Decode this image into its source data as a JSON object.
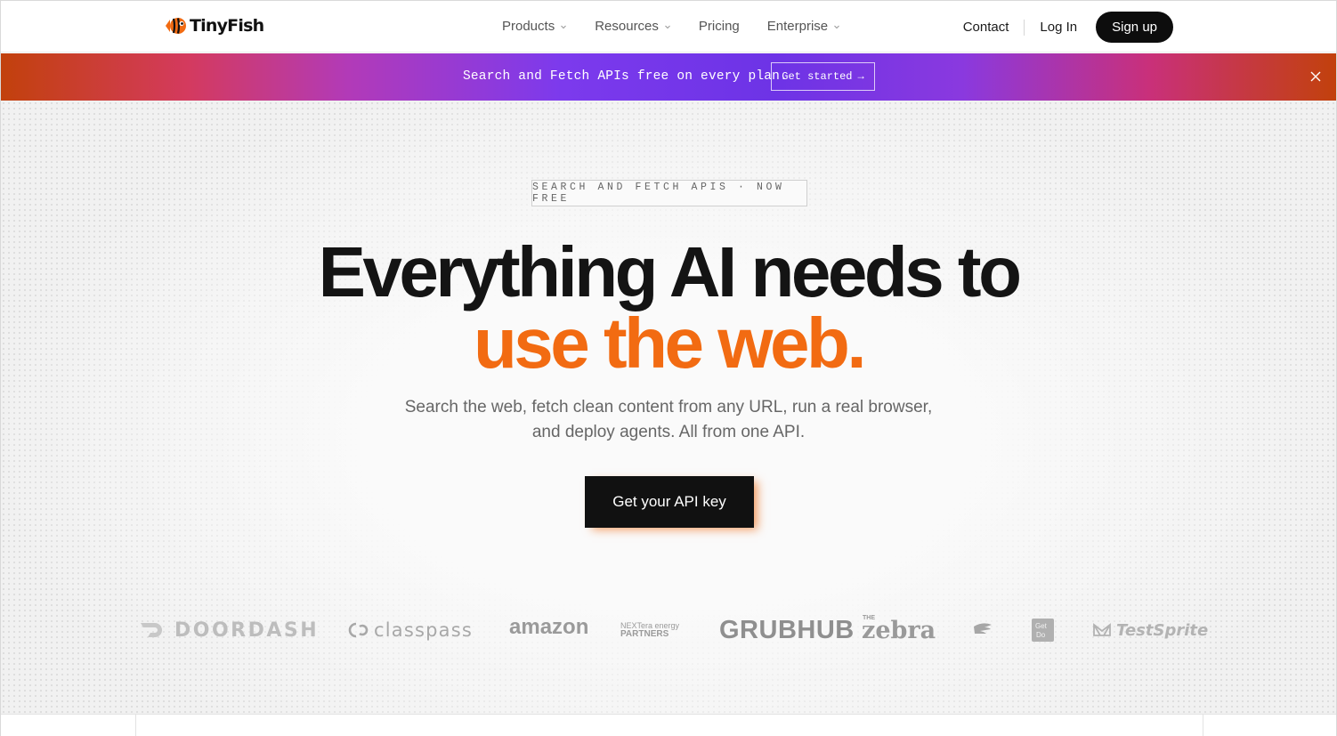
{
  "nav": {
    "brand": "TinyFish",
    "links": [
      {
        "label": "Products",
        "dropdown": true
      },
      {
        "label": "Resources",
        "dropdown": true
      },
      {
        "label": "Pricing",
        "dropdown": false
      },
      {
        "label": "Enterprise",
        "dropdown": true
      }
    ],
    "contact": "Contact",
    "login": "Log In",
    "signup": "Sign up"
  },
  "banner": {
    "text": "Search and Fetch APIs free on every plan.",
    "button": "Get started",
    "button_arrow": "→",
    "close_icon": "close-icon"
  },
  "hero": {
    "eyebrow": "SEARCH AND FETCH APIS · NOW FREE",
    "headline_line1": "Everything AI needs to",
    "headline_line2": "use the web.",
    "subtitle_line1": "Search the web, fetch clean content from any URL, run a real browser,",
    "subtitle_line2": "and deploy agents. All from one API.",
    "cta": "Get your API key"
  },
  "logos": {
    "doordash": "DOORDASH",
    "classpass": "classpass",
    "amazon": "amazon",
    "nextera_line1": "NEXTera energy",
    "nextera_line2": "PARTNERS",
    "grubhub": "GRUBHUB",
    "zebra": "zebra",
    "zebra_small": "THE",
    "getdo": "Get Do",
    "testsprite": "TestSprite"
  },
  "colors": {
    "accent": "#f26b12",
    "dark": "#111111",
    "banner_purple": "#7c3aed"
  }
}
